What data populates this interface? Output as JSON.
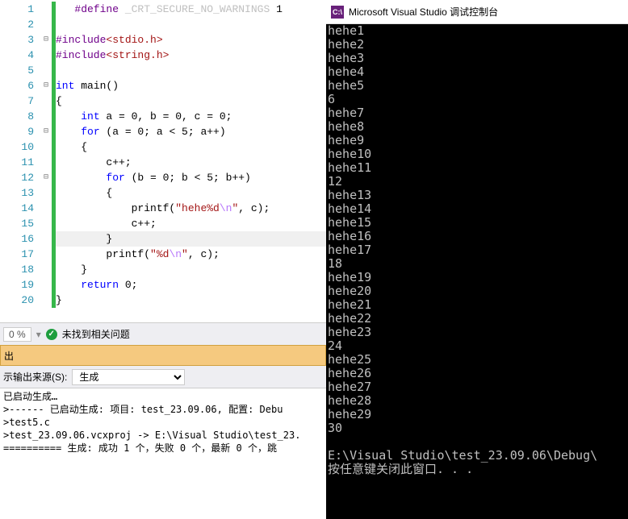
{
  "editor": {
    "lines": [
      {
        "n": 1,
        "fold": "",
        "bar": true
      },
      {
        "n": 2,
        "fold": "",
        "bar": true
      },
      {
        "n": 3,
        "fold": "⊟",
        "bar": true
      },
      {
        "n": 4,
        "fold": "",
        "bar": true
      },
      {
        "n": 5,
        "fold": "",
        "bar": true
      },
      {
        "n": 6,
        "fold": "⊟",
        "bar": true
      },
      {
        "n": 7,
        "fold": "",
        "bar": true
      },
      {
        "n": 8,
        "fold": "",
        "bar": true
      },
      {
        "n": 9,
        "fold": "⊟",
        "bar": true
      },
      {
        "n": 10,
        "fold": "",
        "bar": true
      },
      {
        "n": 11,
        "fold": "",
        "bar": true
      },
      {
        "n": 12,
        "fold": "⊟",
        "bar": true
      },
      {
        "n": 13,
        "fold": "",
        "bar": true
      },
      {
        "n": 14,
        "fold": "",
        "bar": true
      },
      {
        "n": 15,
        "fold": "",
        "bar": true
      },
      {
        "n": 16,
        "fold": "",
        "bar": true,
        "hl": true
      },
      {
        "n": 17,
        "fold": "",
        "bar": true
      },
      {
        "n": 18,
        "fold": "",
        "bar": true
      },
      {
        "n": 19,
        "fold": "",
        "bar": true
      },
      {
        "n": 20,
        "fold": "",
        "bar": true
      }
    ],
    "code": {
      "l1_define": "#define",
      "l1_macro": "_CRT_SECURE_NO_WARNINGS",
      "l1_val": " 1",
      "l3_inc": "#include",
      "l3_hdr": "<stdio.h>",
      "l4_inc": "#include",
      "l4_hdr": "<string.h>",
      "l6_int": "int",
      "l6_main": " main()",
      "l7": "{",
      "l8_int": "int",
      "l8_rest": " a = 0, b = 0, c = 0;",
      "l9_for": "for",
      "l9_rest": " (a = 0; a < 5; a++)",
      "l10": "{",
      "l11": "c++;",
      "l12_for": "for",
      "l12_rest": " (b = 0; b < 5; b++)",
      "l13": "{",
      "l14_printf": "printf(",
      "l14_s1": "\"hehe%d",
      "l14_esc": "\\n",
      "l14_s2": "\"",
      "l14_rest": ", c);",
      "l15": "c++;",
      "l16": "}",
      "l17_printf": "printf(",
      "l17_s1": "\"%d",
      "l17_esc": "\\n",
      "l17_s2": "\"",
      "l17_rest": ", c);",
      "l18": "}",
      "l19_ret": "return",
      "l19_rest": " 0;",
      "l20": "}"
    }
  },
  "status": {
    "percent": "0 %",
    "no_issues": "未找到相关问题"
  },
  "output_header": "出",
  "output_toolbar": {
    "label": "示输出来源(S):",
    "value": "生成"
  },
  "output_text": "已启动生成…\n>------ 已启动生成: 项目: test_23.09.06, 配置: Debu\n>test5.c\n>test_23.09.06.vcxproj -> E:\\Visual Studio\\test_23.\n========== 生成: 成功 1 个，失败 0 个，最新 0 个，跳",
  "console": {
    "title": "Microsoft Visual Studio 调试控制台",
    "icon_text": "C:\\",
    "body": "hehe1\nhehe2\nhehe3\nhehe4\nhehe5\n6\nhehe7\nhehe8\nhehe9\nhehe10\nhehe11\n12\nhehe13\nhehe14\nhehe15\nhehe16\nhehe17\n18\nhehe19\nhehe20\nhehe21\nhehe22\nhehe23\n24\nhehe25\nhehe26\nhehe27\nhehe28\nhehe29\n30\n\nE:\\Visual Studio\\test_23.09.06\\Debug\\\n按任意键关闭此窗口. . ."
  }
}
